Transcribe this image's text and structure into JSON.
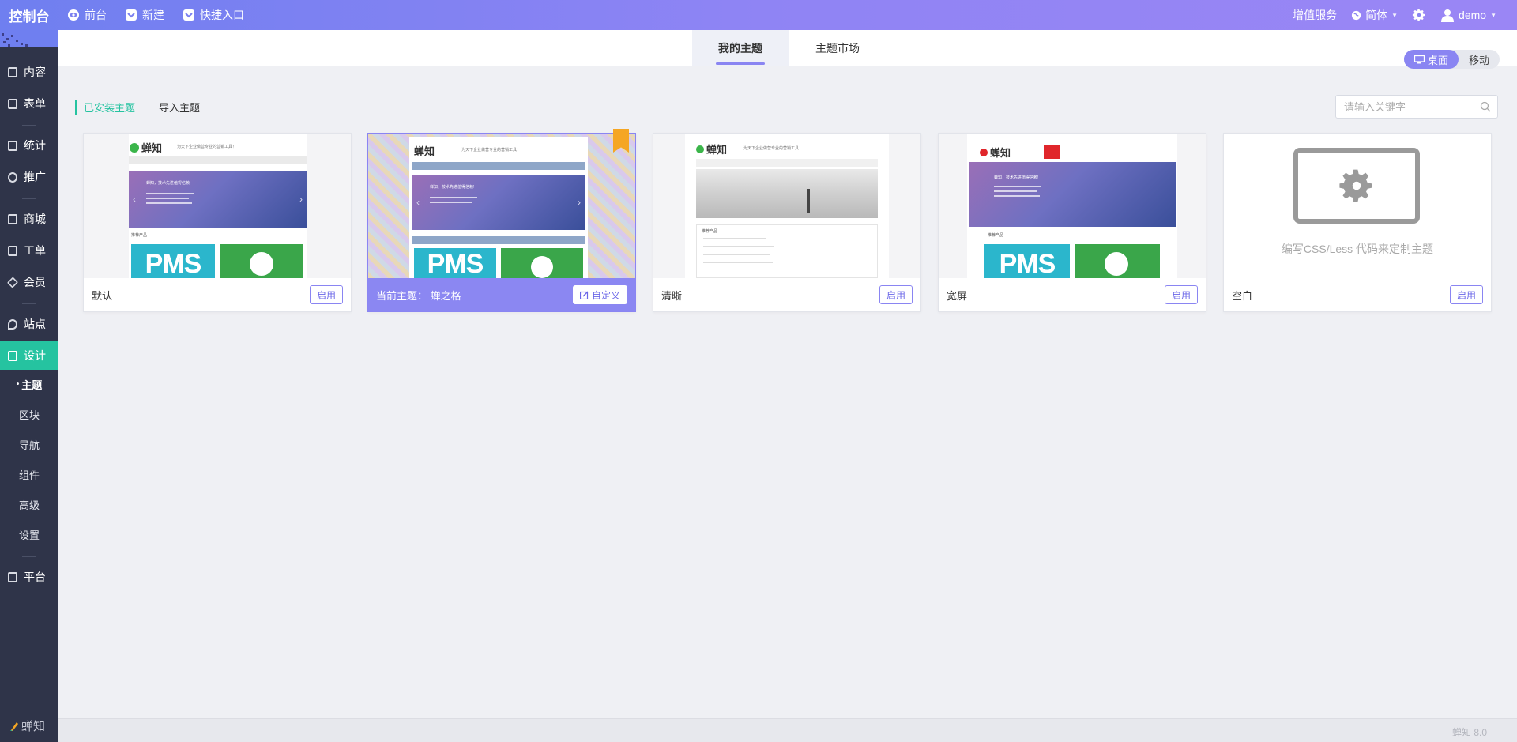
{
  "app": {
    "brand": "控制台",
    "version_brand": "蝉知",
    "version": "8.0"
  },
  "topnav": {
    "items": [
      {
        "label": "前台",
        "icon": "eye-icon"
      },
      {
        "label": "新建",
        "icon": "plus-box-icon"
      },
      {
        "label": "快捷入口",
        "icon": "chevron-box-icon"
      }
    ],
    "right": {
      "vas": "增值服务",
      "lang": "简体",
      "lang_icon": "globe-icon",
      "settings_icon": "gear-icon",
      "user": "demo"
    }
  },
  "sidebar": {
    "items": [
      {
        "label": "内容",
        "icon": "content-icon"
      },
      {
        "label": "表单",
        "icon": "form-icon"
      },
      {
        "label": "统计",
        "icon": "stats-icon"
      },
      {
        "label": "推广",
        "icon": "promote-icon"
      },
      {
        "label": "商城",
        "icon": "shop-icon"
      },
      {
        "label": "工单",
        "icon": "ticket-icon"
      },
      {
        "label": "会员",
        "icon": "member-icon"
      },
      {
        "label": "站点",
        "icon": "site-icon"
      },
      {
        "label": "设计",
        "icon": "design-icon"
      },
      {
        "label": "平台",
        "icon": "platform-icon"
      }
    ],
    "design_sub": [
      {
        "label": "主题"
      },
      {
        "label": "区块"
      },
      {
        "label": "导航"
      },
      {
        "label": "组件"
      },
      {
        "label": "高级"
      },
      {
        "label": "设置"
      }
    ],
    "logo": "蝉知"
  },
  "tabs": [
    {
      "label": "我的主题"
    },
    {
      "label": "主题市场"
    }
  ],
  "device": {
    "desktop": "桌面",
    "mobile": "移动"
  },
  "subtabs": {
    "installed": "已安装主题",
    "import": "导入主题"
  },
  "search": {
    "placeholder": "请输入关键字"
  },
  "themes": [
    {
      "name": "默认",
      "button": "启用"
    },
    {
      "name": "当前主题：  蝉之格",
      "button": "自定义",
      "current": true
    },
    {
      "name": "清晰",
      "button": "启用"
    },
    {
      "name": "宽屏",
      "button": "启用"
    },
    {
      "name": "空白",
      "button": "启用",
      "hint": "编写CSS/Less 代码来定制主题"
    }
  ],
  "preview": {
    "site_logo": "蝉知",
    "tagline": "为天下企业做营专业的营销工具！",
    "banner_text": "蝉知，技术先进值得信赖!",
    "pms": "PMS",
    "section": "推荐产品"
  },
  "colors": {
    "accent": "#8a85f2",
    "green": "#25c3a0",
    "sidebar_bg": "#2f3449",
    "topbar_start": "#6f7ff0",
    "topbar_end": "#9a86f5"
  }
}
